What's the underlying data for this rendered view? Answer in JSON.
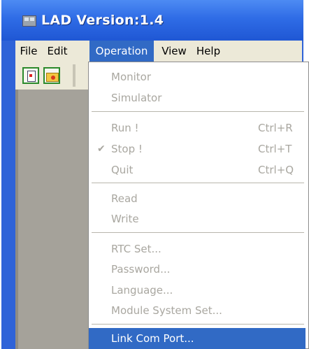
{
  "window": {
    "title": "LAD Version:1.4"
  },
  "menubar": [
    {
      "label": "File"
    },
    {
      "label": "Edit"
    },
    {
      "label": "Operation"
    },
    {
      "label": "View"
    },
    {
      "label": "Help"
    }
  ],
  "operation_menu": {
    "items": [
      {
        "label": "Monitor",
        "shortcut": "",
        "enabled": false
      },
      {
        "label": "Simulator",
        "shortcut": "",
        "enabled": false
      },
      {
        "label": "Run !",
        "shortcut": "Ctrl+R",
        "enabled": false
      },
      {
        "label": "Stop !",
        "shortcut": "Ctrl+T",
        "enabled": false,
        "checked": true,
        "check_icon": "checkmark-icon"
      },
      {
        "label": "Quit",
        "shortcut": "Ctrl+Q",
        "enabled": false
      },
      {
        "label": "Read",
        "shortcut": "",
        "enabled": false
      },
      {
        "label": "Write",
        "shortcut": "",
        "enabled": false
      },
      {
        "label": "RTC Set...",
        "shortcut": "",
        "enabled": false
      },
      {
        "label": "Password...",
        "shortcut": "",
        "enabled": false
      },
      {
        "label": "Language...",
        "shortcut": "",
        "enabled": false
      },
      {
        "label": "Module System Set...",
        "shortcut": "",
        "enabled": false
      },
      {
        "label": "Link Com Port...",
        "shortcut": "",
        "enabled": true,
        "highlighted": true
      }
    ]
  },
  "toolbar": {
    "buttons": [
      {
        "icon": "new-document-icon"
      },
      {
        "icon": "open-folder-icon"
      }
    ]
  },
  "colors": {
    "titlebar": "#2f6ce6",
    "menu_highlight": "#316ac5",
    "disabled_text": "#a9a7a0",
    "menubar": "#ece9d8"
  }
}
